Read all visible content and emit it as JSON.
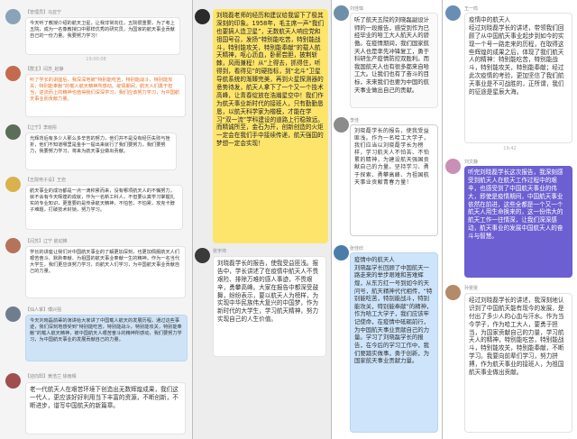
{
  "panel1": {
    "messages": [
      {
        "name": "【管理员】马亚宁",
        "text": "今天听了教授介绍的航天卫星，让我非常向往，五院很重要，为了考上五院，成为一名像教授口中那样优秀的研究员，为国家的航天事业贡献自己的一份力量。我要努力学习！",
        "style": "normal"
      },
      {
        "name": "【群主】闫苏_赵静",
        "text": "听了学长的讲座后，我深深地被“特别能吃苦，特别能战斗，特别能攻关，特别能奉献”的载人航天精神所感动。疫情期间，航天人们勇于担当，逆流而上的精神也值得我们深深学习，我们应该努力学习，为中国航天事业而贡献力量。",
        "style": "orange"
      },
      {
        "name": "【辽宁】李晓彤",
        "text": "光辉背后有多少人那么多辛苦的努力，他们并不是没有经历失败与挫折，他们不知道哪里是金手一提出来就行了我们要努力，我们要努力，我要努力学习，将来为航天事业做出贡献。",
        "style": "normal"
      },
      {
        "name": "【五院电子设】王岩",
        "text": "航天事业的成功都是一点一滴积累而来，没有哪项航天人的不懈努力，就不会有今天辉煌的成就，作为一名新工科人，不但要认真学习掌握扎实的专业知识，更重要的是传承航天精神，不怕苦，不怕累，攻克卡脖子难题，打破技术封锁，努力学习。",
        "style": "normal"
      },
      {
        "name": "【闫苏】辽宁 航动推",
        "text": "学长的讲座让我们对中国航天事业的了解更加深刻，也更加佩服航天人们艰苦奋斗、默默奉献、为祖国的航天事业奉献一生的精神。作为一名当代大学生，我们更应该努力学习，向航天人们学习，为中国航天事业贡献自己的力量。",
        "style": "normal"
      },
      {
        "name": "【仙人掌】傅兴强",
        "text": "今天刘晓磊前辈的演讲给大家讲了中国载人航天的发展历程，通过这些事迹，我们深刻地感受到“特别能吃苦，特别能战斗，特别能攻关，特别能奉献”的载人航天精神，被中国航天人艰苦奋斗的精神所感动，我们要努力学习，为中国航天事业的发展贡献自己的力量。",
        "style": "blue"
      },
      {
        "name": "【迎向阳】黄浩兰 徐雨晴",
        "text": "老一代航天人在艰苦环境下创造出无数辉煌成果，我们这一代人，更应该好好利用当下丰富的资源，不断创新，不断进步，谱写中国航天的新篇章。",
        "style": "normal"
      }
    ],
    "timestamps": [
      "19:00:08"
    ]
  },
  "panel2": {
    "messages": [
      {
        "name": "",
        "text": "刘晓磊老师的经历和建议给我留下了极其深刻的印象。1958年，毛主席一声“我们也要搞人造卫星”，无数航天人响应党和祖国号召，发扬“特别能吃苦，特别能战斗，特别能攻关，特别能奉献”的载人航天精神，呕心沥血，卧薪尝胆，披荆斩棘，风雨兼程！从“上得去，抓得住，听得到，看得见”的硬指标，到“北斗”卫星导航系统的渐臻完美，再到火星探测器的意势待发，航天人拿下了一个又一个技术高峰，让青春绽放在浩瀚星空中！我们作为航天事业新时代的接班人，只有勤勤恳恳，以航天科学家为楷模，才能在学习“双一流”学科建设的道路上行稳致远。而精诚所至，金石为开，创新创造的火炬一定会在我们手中接续传递，航天强国的梦想一定会实现！",
        "style": "yellow"
      },
      {
        "name": "张宇帅",
        "text": "刘晓磊学长的报告，使我受益匪浅。报告中，学长讲述了在疫情中航天人不畏艰险、排除万难的感人事迹，不畏艰辛，勇攀高峰。大家在报告中都深受鼓舞，纷纷表示，要以航天人为榜样，为实现中华民族伟大复兴的中国梦，作为新时代的大学生，学习航天精神，努力实现自己的人生价值。",
        "style": "white"
      }
    ]
  },
  "panel3": {
    "messages": [
      {
        "name": "刘佳琪",
        "text": "听了航天五院的刘晓磊副设计师的一段报告，感受到作为已经毕业的哈工大人航天人的骄傲。在疫情期间，我们国家航天人也是率先冲锋复工，勇于科研生产疫情防控双胜利。而我国航天人也有很多都来自哈工大。让我们也有了奋斗的目标，未来我们也要为中国的航天事业做出自己的贡献。",
        "style": "white"
      },
      {
        "name": "李佳",
        "text": "刘晓磊学长的报告，使我受益匪浅。作为一名哈工大学子，我们应当以刘晓磊学长为榜样，学习航天人不怕苦、不怕累的精神，为建设航天强国贡献自己的力量。坚持学习、勇于探索、勇攀高峰、为祖国航天事业贡献青春力量！",
        "style": "hand"
      },
      {
        "name": "张佳欣",
        "text": "疫情中的航天人\n刘晓磊学长回顾了中国航天一路走来的举步艰难和苦难辉煌，从东方红一号到如今的天问号，航天精神代代相传，“特别能吃苦，特别能战斗，特别能攻关，特别能奉献”的精神，作为哈工大学子，我们应该牢记使命，在疫情中砥砺前行，为中国航天事业贡献自己的力量。学习了刘晓磊学长的报告，在今后的学习工作中，我们要踏实做事，勇于创新，为国家航天事业贡献力量。",
        "style": "blue"
      }
    ],
    "timestamps": [
      "19:42"
    ]
  },
  "panel4": {
    "messages": [
      {
        "name": "王一鸣",
        "text": "疫情中的航天人\n经过刘晓磊学长的讲述，带领我们回顾了从中国航天事业起步到如今的实现一个号一路走来的历程，在取得这些辉煌的成果之后，体现了我们航天人的精神：特别能吃苦，特别能战斗，特别能攻关，特别能奉献；经过此次疫情的考验，更加坚信了我们航天事业是不可战胜的，正所谓，我们的征途是星辰大海。",
        "style": "white"
      },
      {
        "name": "刘文静",
        "text": "听完刘晓磊学长这次报告，我深刻感受到航天人在航天工作过程中的艰辛，也感受到了中国航天事业的伟大，即使是疫情期间，中国航天事业依然在前进，这些全都是一个又一个航天人用生命换来的，这一份伟大的航天工作一往情深，让我们深深感动，航天事业的发展中国航天人的奋斗与智慧。",
        "style": "purple"
      },
      {
        "name": "孙雯雯",
        "text": "经过刘晓磊学长的讲述，我深刻地认识到了中国航天能有现今的发展，是付出了多少人的心血与汗水。作为当今学子，作为哈工大人，要勇于担当，为国家贡献自己的力量，学习航天人的精神，特别能吃苦，特别能战斗，特别能攻关，特别能奉献，不断学习。我要向前辈们学习，努力拼搏，作为航天事业的接班人，为祖国航天事业做出贡献。",
        "style": "white"
      }
    ],
    "timestamps": [
      "19:42"
    ]
  }
}
